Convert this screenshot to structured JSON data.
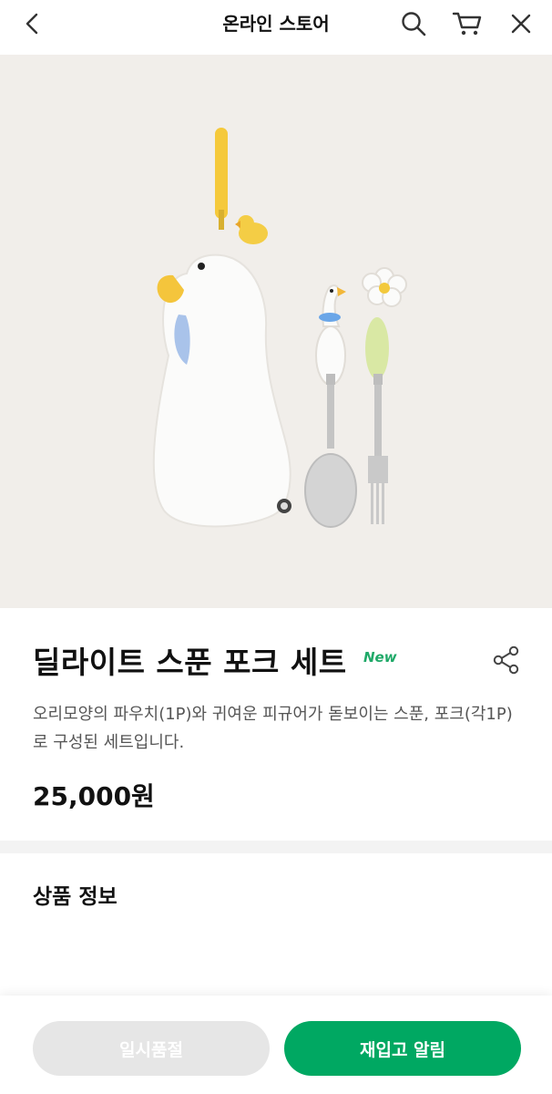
{
  "header": {
    "title": "온라인 스토어",
    "icons": [
      "chevron-left-icon",
      "search-icon",
      "cart-icon",
      "close-icon"
    ]
  },
  "product": {
    "title": "딜라이트 스푼 포크 세트",
    "badge": "New",
    "description": "오리모양의 파우치(1P)와 귀여운 피규어가 돋보이는 스푼, 포크(각1P)로 구성된 세트입니다.",
    "price": "25,000원"
  },
  "sections": {
    "info_title": "상품 정보"
  },
  "actions": {
    "soldout_label": "일시품절",
    "restock_label": "재입고 알림"
  },
  "colors": {
    "accent": "#00a862",
    "new_badge": "#1fa968",
    "image_bg": "#f1eeea",
    "disabled": "#e6e6e6"
  }
}
